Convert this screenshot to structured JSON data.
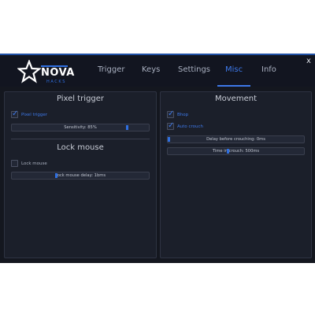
{
  "logo": {
    "name": "NOVA",
    "sub": "HACKS"
  },
  "tabs": [
    {
      "label": "Trigger",
      "active": false
    },
    {
      "label": "Keys",
      "active": false
    },
    {
      "label": "Settings",
      "active": false
    },
    {
      "label": "Misc",
      "active": true
    },
    {
      "label": "Info",
      "active": false
    }
  ],
  "close_label": "x",
  "left_panel": {
    "pixel_trigger": {
      "title": "Pixel trigger",
      "checkbox": {
        "label": "Pixel trigger",
        "checked": true
      },
      "slider": {
        "label": "Sensitivity: 85%",
        "value_fraction": 0.85
      }
    },
    "lock_mouse": {
      "title": "Lock mouse",
      "checkbox": {
        "label": "Lock mouse",
        "checked": false
      },
      "slider": {
        "label": "Lock mouse delay: 1bms",
        "value_fraction": 0.32
      }
    }
  },
  "right_panel": {
    "title": "Movement",
    "checkboxes": [
      {
        "label": "Bhop",
        "checked": true
      },
      {
        "label": "Auto crouch",
        "checked": true
      }
    ],
    "sliders": [
      {
        "label": "Delay before crouching: 0ms",
        "value_fraction": 0.0
      },
      {
        "label": "Time in crouch: 500ms",
        "value_fraction": 0.44
      }
    ]
  },
  "colors": {
    "accent": "#3d78e8",
    "background": "#14171f",
    "panel": "#1b1f2a"
  }
}
